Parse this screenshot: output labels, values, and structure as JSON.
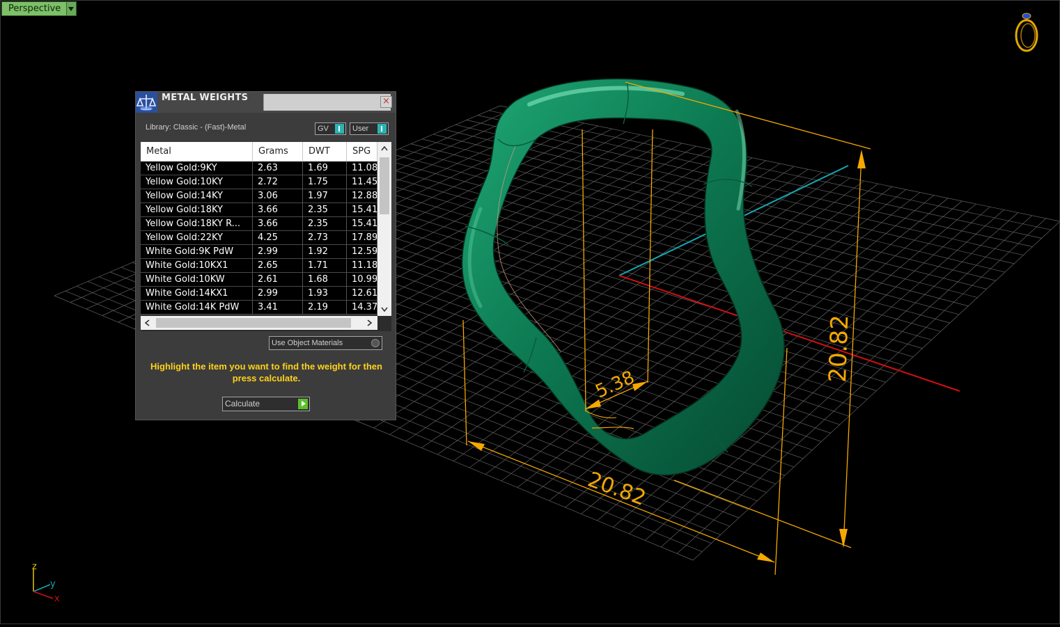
{
  "viewport": {
    "view_label": "Perspective",
    "dimensions": {
      "width_label": "20.82",
      "height_label": "20.82",
      "thickness_label": "5.38"
    },
    "axes": {
      "z": "z",
      "y": "y",
      "x": "x"
    },
    "colors": {
      "ring": "#0e7a52",
      "dimension": "#f5a800",
      "grid": "#8a8a8a",
      "x_axis": "#d01010",
      "y_axis": "#15a6b0"
    }
  },
  "panel": {
    "title": "METAL WEIGHTS",
    "close": "×",
    "library_label": "Library: Classic - (Fast)-Metal",
    "toggle_gv": "GV",
    "toggle_user": "User",
    "columns": [
      "Metal",
      "Grams",
      "DWT",
      "SPG"
    ],
    "rows": [
      [
        "Yellow Gold:9KY",
        "2.63",
        "1.69",
        "11.08"
      ],
      [
        "Yellow Gold:10KY",
        "2.72",
        "1.75",
        "11.45"
      ],
      [
        "Yellow Gold:14KY",
        "3.06",
        "1.97",
        "12.88"
      ],
      [
        "Yellow Gold:18KY",
        "3.66",
        "2.35",
        "15.41"
      ],
      [
        "Yellow Gold:18KY R...",
        "3.66",
        "2.35",
        "15.41"
      ],
      [
        "Yellow Gold:22KY",
        "4.25",
        "2.73",
        "17.89"
      ],
      [
        "White Gold:9K PdW",
        "2.99",
        "1.92",
        "12.59"
      ],
      [
        "White Gold:10KX1",
        "2.65",
        "1.71",
        "11.18"
      ],
      [
        "White Gold:10KW",
        "2.61",
        "1.68",
        "10.99"
      ],
      [
        "White Gold:14KX1",
        "2.99",
        "1.93",
        "12.61"
      ],
      [
        "White Gold:14K PdW",
        "3.41",
        "2.19",
        "14.37"
      ]
    ],
    "use_object_materials": "Use Object Materials",
    "instructions": "Highlight the item you want to find the weight for then press calculate.",
    "calculate_label": "Calculate"
  }
}
